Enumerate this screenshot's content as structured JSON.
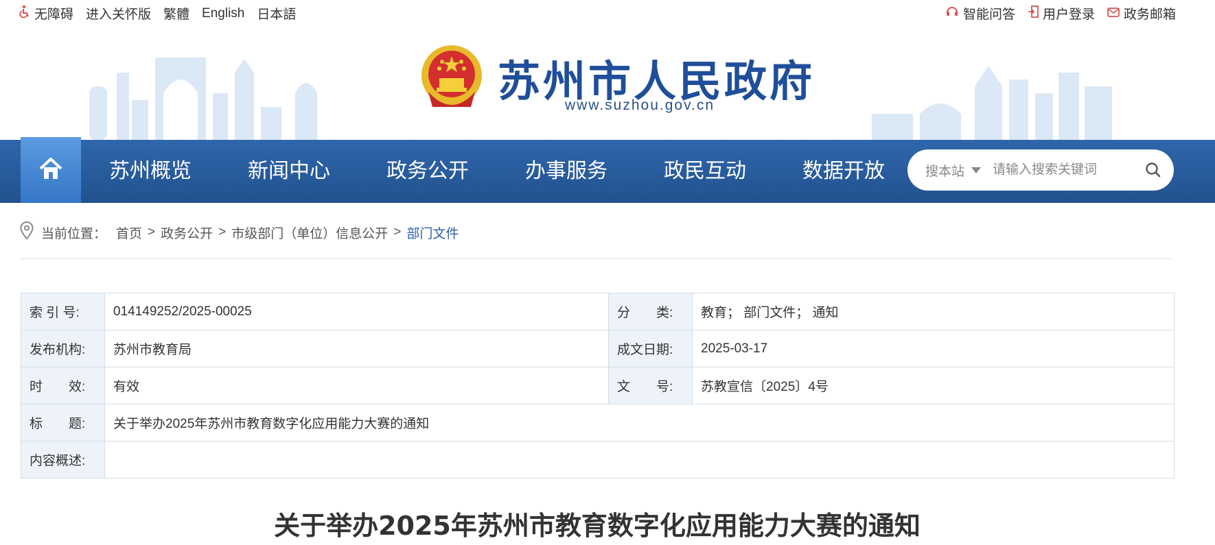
{
  "topbar": {
    "left": [
      {
        "icon": "wheelchair-icon",
        "label": "无障碍"
      },
      {
        "label": "进入关怀版"
      },
      {
        "label": "繁體"
      },
      {
        "label": "English"
      },
      {
        "label": "日本語"
      }
    ],
    "right": [
      {
        "icon": "headset-icon",
        "label": "智能问答"
      },
      {
        "icon": "login-icon",
        "label": "用户登录"
      },
      {
        "icon": "mail-icon",
        "label": "政务邮箱"
      }
    ]
  },
  "header": {
    "title": "苏州市人民政府",
    "url": "www.suzhou.gov.cn"
  },
  "nav": {
    "home_icon": "home-icon",
    "items": [
      "苏州概览",
      "新闻中心",
      "政务公开",
      "办事服务",
      "政民互动",
      "数据开放"
    ]
  },
  "search": {
    "scope": "搜本站",
    "placeholder": "请输入搜索关键词",
    "button_icon": "search-icon"
  },
  "breadcrumb": {
    "prefix": "当前位置：",
    "items": [
      "首页",
      "政务公开",
      "市级部门（单位）信息公开",
      "部门文件"
    ],
    "separator": ">"
  },
  "info": {
    "index_label": "索 引 号:",
    "index_value": "014149252/2025-00025",
    "category_label": "分　　类:",
    "category_value": "教育； 部门文件； 通知",
    "publisher_label": "发布机构:",
    "publisher_value": "苏州市教育局",
    "date_label": "成文日期:",
    "date_value": "2025-03-17",
    "validity_label": "时　　效:",
    "validity_value": "有效",
    "docno_label": "文　　号:",
    "docno_value": "苏教宣信〔2025〕4号",
    "title_label": "标　　题:",
    "title_value": "关于举办2025年苏州市教育数字化应用能力大赛的通知",
    "summary_label": "内容概述:",
    "summary_value": ""
  },
  "document": {
    "title": "关于举办2025年苏州市教育数字化应用能力大赛的通知"
  },
  "colors": {
    "nav_bg": "#2a5c9f",
    "home_active": "#4a8ad6",
    "brand_blue": "#1f4e9a",
    "table_label_bg": "#eef3fa",
    "table_border": "#d3dde8"
  }
}
